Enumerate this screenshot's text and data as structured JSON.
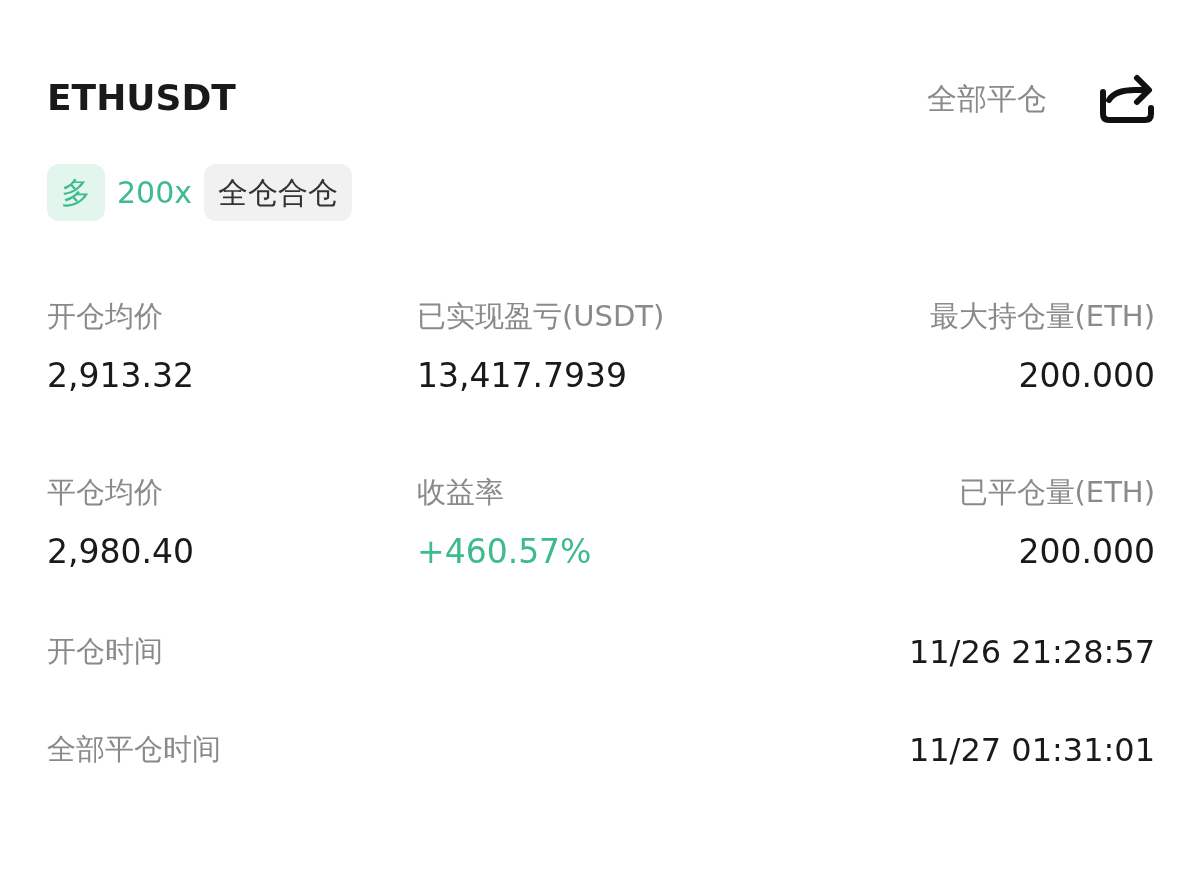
{
  "header": {
    "symbol": "ETHUSDT",
    "close_all": "全部平仓"
  },
  "tags": [
    {
      "text": "多",
      "kind": "side"
    },
    {
      "text": "200x",
      "kind": "leverage"
    },
    {
      "text": "全仓合仓",
      "kind": "mode"
    }
  ],
  "stats": [
    {
      "label": "开仓均价",
      "value": "2,913.32",
      "kind": "plain"
    },
    {
      "label": "已实现盈亏(USDT)",
      "value": "13,417.7939",
      "kind": "plain"
    },
    {
      "label": "最大持仓量(ETH)",
      "value": "200.000",
      "kind": "plain"
    },
    {
      "label": "平仓均价",
      "value": "2,980.40",
      "kind": "plain"
    },
    {
      "label": "收益率",
      "value": "+460.57%",
      "kind": "gain"
    },
    {
      "label": "已平仓量(ETH)",
      "value": "200.000",
      "kind": "plain"
    }
  ],
  "times": [
    {
      "label": "开仓时间",
      "value": "11/26 21:28:57"
    },
    {
      "label": "全部平仓时间",
      "value": "11/27 01:31:01"
    }
  ]
}
